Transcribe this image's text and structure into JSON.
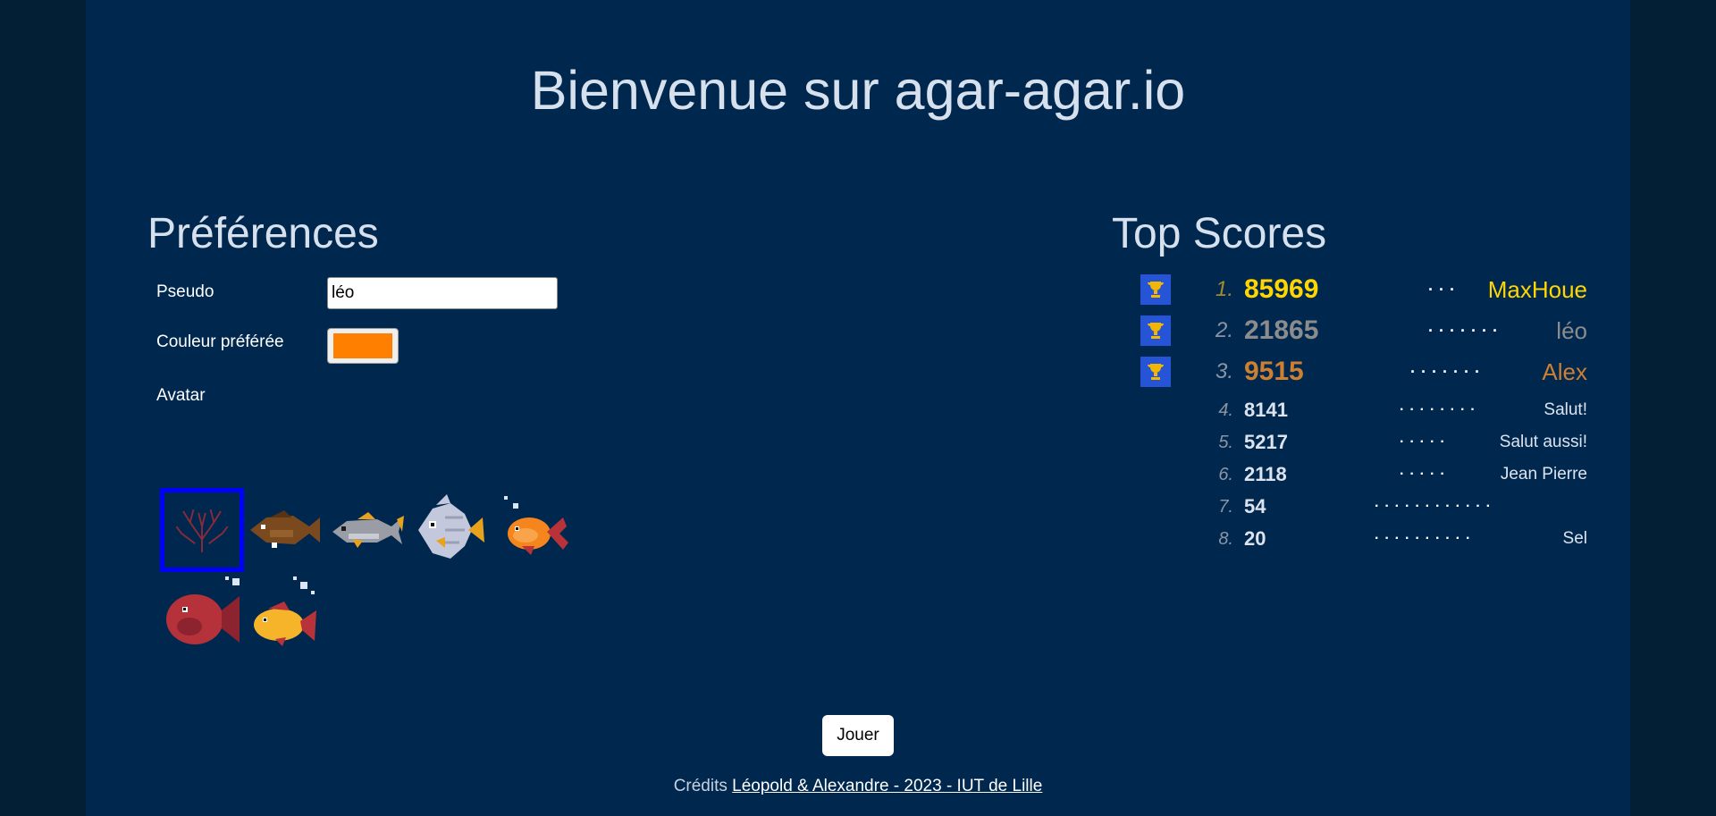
{
  "title": "Bienvenue sur agar-agar.io",
  "preferences": {
    "title": "Préférences",
    "pseudo_label": "Pseudo",
    "pseudo_value": "léo",
    "color_label": "Couleur préférée",
    "color_value": "#ff7f00",
    "avatar_label": "Avatar"
  },
  "top_scores": {
    "title": "Top Scores",
    "rows": [
      {
        "rank": "1.",
        "score": "85969",
        "name": "MaxHoue"
      },
      {
        "rank": "2.",
        "score": "21865",
        "name": "léo"
      },
      {
        "rank": "3.",
        "score": "9515",
        "name": "Alex"
      },
      {
        "rank": "4.",
        "score": "8141",
        "name": "Salut!"
      },
      {
        "rank": "5.",
        "score": "5217",
        "name": "Salut aussi!"
      },
      {
        "rank": "6.",
        "score": "2118",
        "name": "Jean Pierre"
      },
      {
        "rank": "7.",
        "score": "54",
        "name": ""
      },
      {
        "rank": "8.",
        "score": "20",
        "name": "Sel"
      }
    ]
  },
  "play_button": "Jouer",
  "credits": {
    "prefix": "Crédits",
    "link": "Léopold & Alexandre - 2023 - IUT de Lille"
  },
  "colors": {
    "gold": "#ffd600",
    "silver": "#8c8c8c",
    "bronze": "#cd7f32",
    "selected_avatar_border": "#0000ff"
  }
}
